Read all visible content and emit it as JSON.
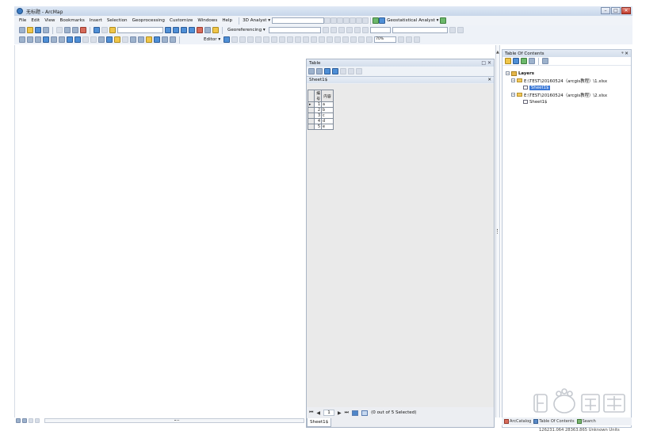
{
  "window": {
    "title": "无标题 - ArcMap",
    "buttons": {
      "minimize": "–",
      "maximize": "□",
      "close": "✕"
    }
  },
  "menubar": {
    "items": [
      "File",
      "Edit",
      "View",
      "Bookmarks",
      "Insert",
      "Selection",
      "Geoprocessing",
      "Customize",
      "Windows",
      "Help"
    ]
  },
  "toolbar": {
    "analyst_3d": "3D Analyst ▾",
    "geostatistical": "Geostatistical Analyst ▾",
    "georeferencing": "Georeferencing ▾",
    "editor": "Editor ▾",
    "zoom_value": "70%"
  },
  "table_window": {
    "title": "Table",
    "controls": "□ ✕",
    "sheet_header": "Sheet1$",
    "columns": [
      "编号",
      "内容"
    ],
    "rows": [
      {
        "id": "1",
        "content": "a"
      },
      {
        "id": "2",
        "content": "b"
      },
      {
        "id": "3",
        "content": "c"
      },
      {
        "id": "4",
        "content": "d"
      },
      {
        "id": "5",
        "content": "e"
      }
    ],
    "current_record": "1",
    "selection_status": "(0 out of 5 Selected)",
    "sheet_tab": "Sheet1$"
  },
  "toc": {
    "title": "Table Of Contents",
    "pin": "ᵠ ✕",
    "root": "Layers",
    "sources": [
      {
        "path": "E:\\TEST\\20160524（arcgis教程）\\1.xlsx",
        "table": "Sheet1$",
        "selected": true
      },
      {
        "path": "E:\\TEST\\20160524（arcgis教程）\\2.xlsx",
        "table": "Sheet1$",
        "selected": false
      }
    ],
    "tabs": [
      "ArcCatalog",
      "Table Of Contents",
      "Search"
    ]
  },
  "status": {
    "coordinates": "126231.064  28363.865 Unknown Units"
  },
  "watermark": {
    "text": "Bai du 经验"
  },
  "colors": {
    "titlebar": "#c7d6ea",
    "selection": "#3b78d6",
    "folder": "#f2c85a"
  }
}
